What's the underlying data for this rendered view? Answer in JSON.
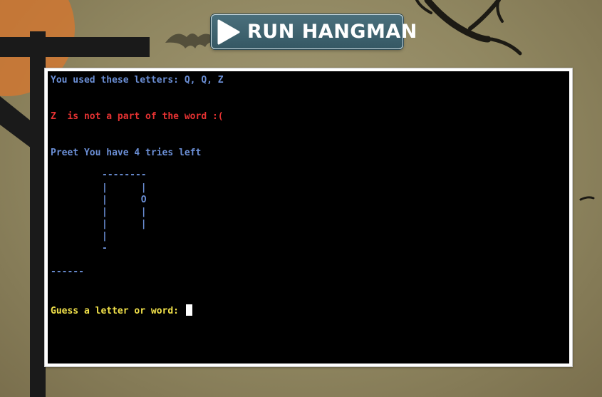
{
  "toolbar": {
    "run_label": "RUN HANGMAN",
    "run_icon": "play-icon"
  },
  "terminal": {
    "used_letters_line": "You used these letters: Q, Q, Z",
    "not_in_word_line": "Z  is not a part of the word :(",
    "tries_line": "Preet You have 4 tries left",
    "gallows": {
      "row_1": "--------",
      "row_2": "|      |",
      "row_3": "|      O",
      "row_4": "|      |",
      "row_5": "|      |",
      "row_6": "|",
      "row_7": "-"
    },
    "word_progress": "------",
    "prompt": "Guess a letter or word: "
  },
  "colors": {
    "terminal_background": "#000000",
    "info_text": "#6b8fd6",
    "error_text": "#e63232",
    "prompt_text": "#f2e24a",
    "button_background": "#3f6472"
  }
}
